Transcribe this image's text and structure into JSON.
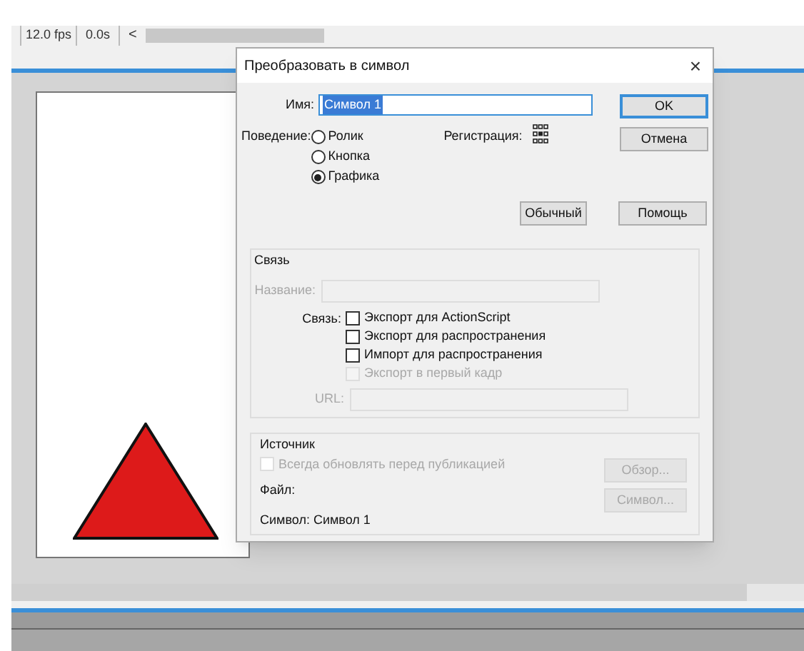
{
  "timeline": {
    "fps": "12.0 fps",
    "time": "0.0s",
    "scroll_left": "<"
  },
  "dialog": {
    "title": "Преобразовать в символ",
    "close": "×",
    "name": {
      "label": "Имя:",
      "value": "Символ 1",
      "text_selected": true
    },
    "behavior": {
      "label": "Поведение:",
      "options": [
        {
          "label": "Ролик",
          "selected": false
        },
        {
          "label": "Кнопка",
          "selected": false
        },
        {
          "label": "Графика",
          "selected": true
        }
      ]
    },
    "registration": {
      "label": "Регистрация:"
    },
    "ok_button": {
      "label": "OK",
      "default": true
    },
    "cancel_button": {
      "label": "Отмена",
      "default": false
    },
    "basic_button": {
      "label": "Обычный",
      "default": false
    },
    "help_button": {
      "label": "Помощь",
      "default": false
    },
    "linkage": {
      "title": "Связь",
      "identifier": {
        "label": "Название:",
        "disabled": true
      },
      "linkage_label": "Связь:",
      "options": [
        {
          "label": "Экспорт для ActionScript",
          "checked": false,
          "disabled": false
        },
        {
          "label": "Экспорт для распространения",
          "checked": false,
          "disabled": false
        },
        {
          "label": "Импорт для распространения",
          "checked": false,
          "disabled": false
        },
        {
          "label": "Экспорт в первый кадр",
          "checked": false,
          "disabled": true
        }
      ],
      "url": {
        "label": "URL:",
        "disabled": true
      }
    },
    "source": {
      "title": "Источник",
      "always_update": {
        "label": "Всегда обновлять перед публикацией",
        "checked": false,
        "disabled": true
      },
      "file_label": "Файл:",
      "symbol_label": "Символ: Символ 1",
      "browse_button": {
        "label": "Обзор...",
        "disabled": true
      },
      "symbol_button": {
        "label": "Символ...",
        "disabled": true
      }
    }
  }
}
